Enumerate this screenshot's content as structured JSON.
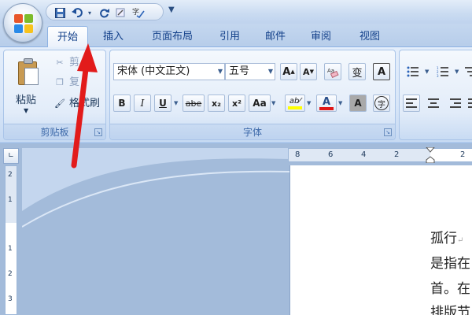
{
  "quick_access": {
    "save_icon": "save-icon",
    "undo_icon": "undo-icon",
    "redo_icon": "repeat-icon",
    "format_icon": "format-icon",
    "spell_icon": "spelling-icon"
  },
  "tabs": [
    {
      "label": "开始",
      "active": true
    },
    {
      "label": "插入"
    },
    {
      "label": "页面布局"
    },
    {
      "label": "引用"
    },
    {
      "label": "邮件"
    },
    {
      "label": "审阅"
    },
    {
      "label": "视图"
    }
  ],
  "clipboard": {
    "paste_label": "粘贴",
    "cut_label": "剪",
    "copy_label": "复",
    "format_painter_label": "格式刷",
    "group_label": "剪贴板"
  },
  "font": {
    "family_value": "宋体 (中文正文)",
    "size_value": "五号",
    "grow_label": "A",
    "shrink_label": "A",
    "phonetic_label": "变",
    "border_label": "A",
    "bold": "B",
    "italic": "I",
    "underline": "U",
    "strike": "abe",
    "subscript": "x₂",
    "superscript": "x²",
    "case": "Aa",
    "highlight": "ab⁄",
    "font_color": "A",
    "shading": "A",
    "enclose": "字",
    "group_label": "字体",
    "colors": {
      "highlight": "#ffff00",
      "font_color": "#e01818"
    }
  },
  "rulers": {
    "h_ticks": [
      "8",
      "6",
      "4",
      "2",
      "2"
    ],
    "v_ticks": [
      "2",
      "1",
      "1",
      "2",
      "3"
    ]
  },
  "document": {
    "lines": [
      "孤行",
      "是指在",
      "首。在",
      "排版节"
    ]
  }
}
